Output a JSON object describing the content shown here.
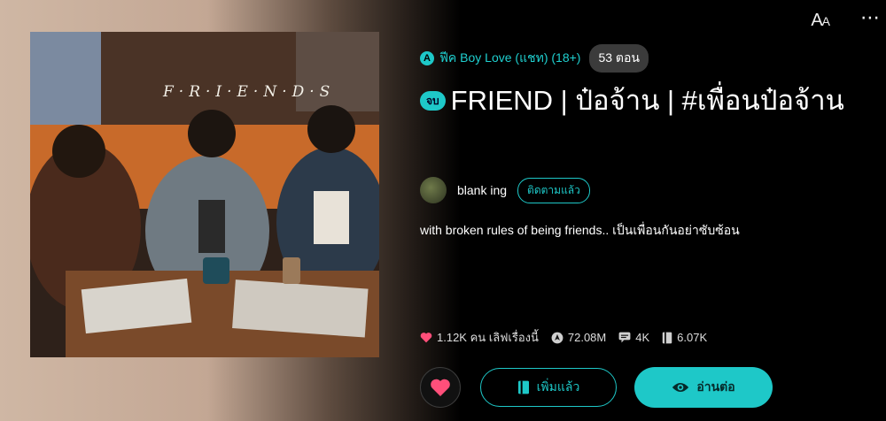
{
  "header": {
    "font_size_label": "A",
    "font_size_small": "A",
    "more_label": "⋯"
  },
  "cover": {
    "logo_text": "F·R·I·E·N·D·S"
  },
  "story": {
    "genre_icon": "A",
    "genre": "ฟีค Boy Love (แชท) (18+)",
    "chapters": "53 ตอน",
    "status": "จบ",
    "title": "FRIEND | ป๋อจ้าน | #เพื่อนป๋อจ้าน",
    "author": "blank ing",
    "follow_label": "ติดตามแล้ว",
    "description": "with broken rules of being friends.. เป็นเพื่อนกันอย่าซับซ้อน"
  },
  "stats": {
    "likes": "1.12K คน เลิฟเรื่องนี้",
    "views": "72.08M",
    "comments": "4K",
    "library": "6.07K"
  },
  "actions": {
    "library_label": "เพิ่มแล้ว",
    "read_label": "อ่านต่อ"
  },
  "colors": {
    "accent": "#1ec8c8",
    "heart": "#ff4f7a",
    "background": "#000000"
  }
}
